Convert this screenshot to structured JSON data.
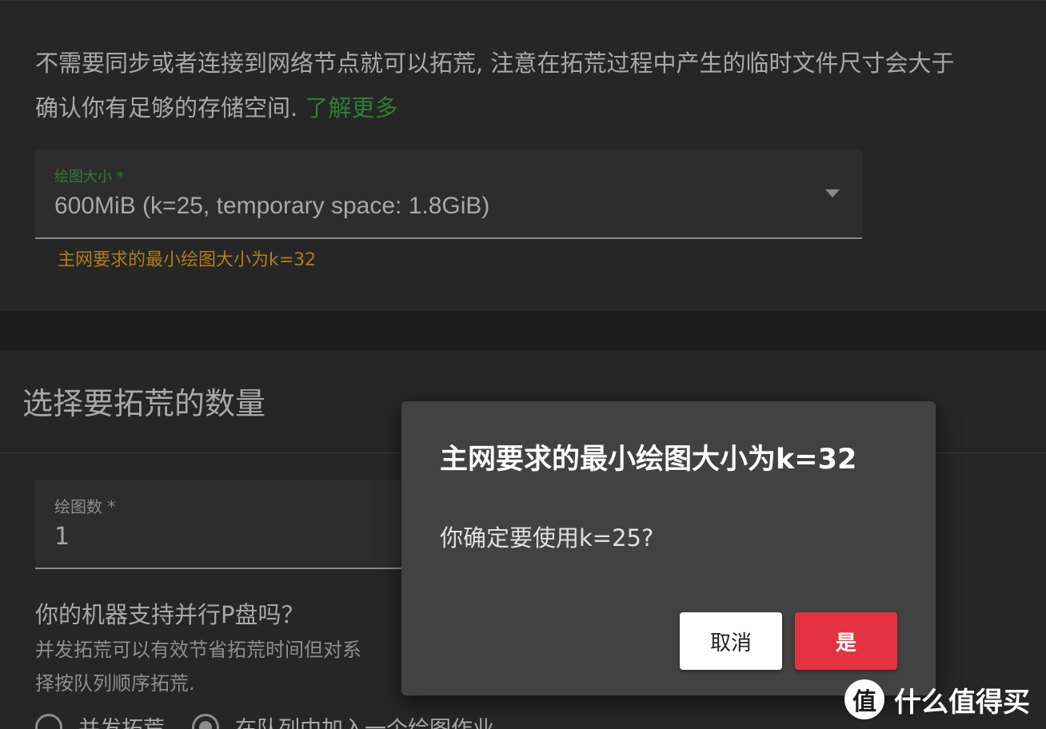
{
  "plot_settings": {
    "description_line1": "不需要同步或者连接到网络节点就可以拓荒, 注意在拓荒过程中产生的临时文件尺寸会大于",
    "description_line2": "确认你有足够的存储空间.",
    "learn_more": "了解更多",
    "size_select": {
      "label": "绘图大小 *",
      "value": "600MiB (k=25, temporary space: 1.8GiB)"
    },
    "warning": "主网要求的最小绘图大小为k=32"
  },
  "plot_count_section": {
    "title": "选择要拓荒的数量",
    "count_field": {
      "label": "绘图数 *",
      "value": "1"
    },
    "parallel_question": "你的机器支持并行P盘吗？",
    "parallel_desc_line1": "并发拓荒可以有效节省拓荒时间但对系",
    "parallel_desc_line2": "择按队列顺序拓荒.",
    "radio_options": [
      {
        "label": "并发拓荒",
        "checked": false
      },
      {
        "label": "在队列中加入一个绘图作业",
        "checked": true
      }
    ]
  },
  "dialog": {
    "title": "主网要求的最小绘图大小为k=32",
    "message": "你确定要使用k=25?",
    "cancel_label": "取消",
    "confirm_label": "是"
  },
  "watermark": {
    "logo_glyph": "值",
    "text": "什么值得买"
  },
  "colors": {
    "accent_green": "#2e7d32",
    "warning_orange": "#b07d18",
    "confirm_red": "#e53240",
    "dialog_bg": "#424242"
  }
}
